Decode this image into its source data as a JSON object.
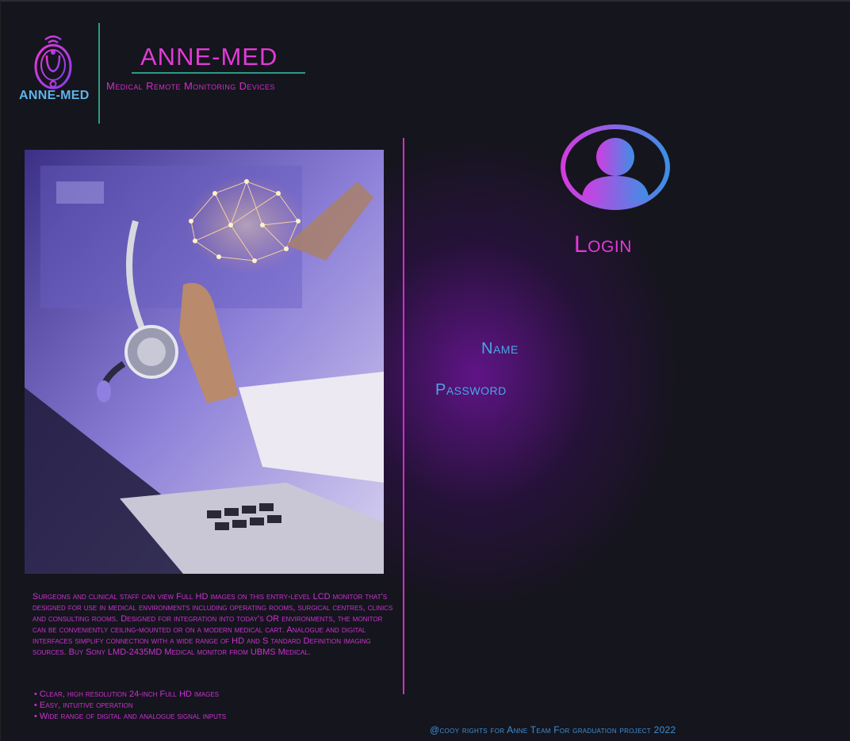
{
  "header": {
    "logo_text": "ANNE-MED",
    "brand_title": "ANNE-MED",
    "tagline": "Medical Remote Monitoring Devices"
  },
  "hero_image": {
    "icon": "medical-tech-photo"
  },
  "description": {
    "paragraph": "Surgeons and clinical staff can view Full HD images on this entry-level LCD monitor that's designed for use in medical environments including operating rooms, surgical centres, clinics and consulting rooms. Designed for integration into today's OR environments, the monitor can be conveniently ceiling-mounted or on a modern medical cart. Analogue and digital interfaces simplify connection with a wide range of HD and S tandard Definition imaging sources. Buy Sony LMD-2435MD Medical monitor from UBMS Medical.",
    "bullets": [
      "• Clear, high resolution 24-inch Full HD images",
      "• Easy, intuitive operation",
      "• Wide range of digital and analogue signal inputs"
    ]
  },
  "login": {
    "avatar_icon": "user-avatar-icon",
    "title": "Login",
    "name_label": "Name",
    "password_label": "Password"
  },
  "footer": {
    "copyright": "@cooy rights for Anne Team For graduation project 2022"
  },
  "colors": {
    "background": "#15151d",
    "accent_pink": "#e23ad6",
    "accent_teal": "#2e9a86",
    "label_blue": "#49a7e6"
  }
}
